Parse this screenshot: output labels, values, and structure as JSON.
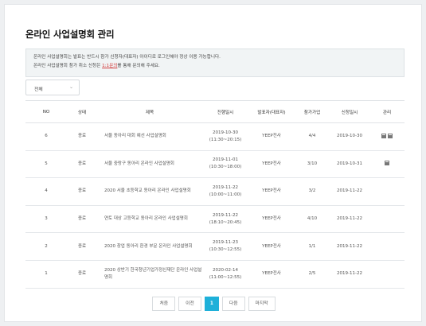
{
  "page": {
    "title": "온라인 사업설명회 관리"
  },
  "notice": {
    "line1": "온라인 사업설명회는 발표는 반드시 참가 신청자(대표자) 아이디로 로그인해야 정상 이용 가능합니다.",
    "line2_pre": "온라인 사업설명회 참가 취소 신청은 ",
    "line2_link": "1:1문의",
    "line2_post": "를 통해 문의해 주세요."
  },
  "filter": {
    "selected": "전체",
    "icon": "chevron-down-icon"
  },
  "table": {
    "columns": [
      "NO",
      "상태",
      "제목",
      "진행일시",
      "발표자(대표자)",
      "참가가업",
      "신청일시",
      "관리"
    ],
    "rows": [
      {
        "no": "6",
        "status": "종료",
        "title": "서울 동아리 대회 예선 사업설명회",
        "date": "2019-10-30",
        "time": "(11:30~20:15)",
        "presenter": "YEEP전사",
        "joined": "4/4",
        "applied": "2019-10-30",
        "mgmt_icons": 2
      },
      {
        "no": "5",
        "status": "종료",
        "title": "서울 중랑구 동아리 온라인 사업설명회",
        "date": "2019-11-01",
        "time": "(10:30~18:00)",
        "presenter": "YEEP전사",
        "joined": "3/10",
        "applied": "2019-10-31",
        "mgmt_icons": 1
      },
      {
        "no": "4",
        "status": "종료",
        "title": "2020 서울 초등학교 동아리 온라인 사업설명회",
        "date": "2019-11-22",
        "time": "(10:00~11:00)",
        "presenter": "YEEP전사",
        "joined": "3/2",
        "applied": "2019-11-22",
        "mgmt_icons": 0
      },
      {
        "no": "3",
        "status": "종료",
        "title": "연토 대상 고등학교 동아리 온라인 사업설명회",
        "date": "2019-11-22",
        "time": "(18:10~20:45)",
        "presenter": "YEEP전사",
        "joined": "4/10",
        "applied": "2019-11-22",
        "mgmt_icons": 0
      },
      {
        "no": "2",
        "status": "종료",
        "title": "2020 창업 동아리 환경 부문 온라인 사업설명회",
        "date": "2019-11-23",
        "time": "(10:30~12:55)",
        "presenter": "YEEP전사",
        "joined": "1/1",
        "applied": "2019-11-22",
        "mgmt_icons": 0
      },
      {
        "no": "1",
        "status": "종료",
        "title": "2020 상반기 한국청년기업가정신재단 온라인 사업설명회",
        "date": "2020-02-14",
        "time": "(11:00~12:55)",
        "presenter": "YEEP전사",
        "joined": "2/5",
        "applied": "2019-11-22",
        "mgmt_icons": 0
      }
    ]
  },
  "pagination": {
    "first": "처음",
    "prev": "이전",
    "current": "1",
    "next": "다음",
    "last": "마지막"
  },
  "colors": {
    "accent": "#1eb0d9",
    "link": "#d23a3a",
    "notice_bg": "#f1f4f5"
  }
}
